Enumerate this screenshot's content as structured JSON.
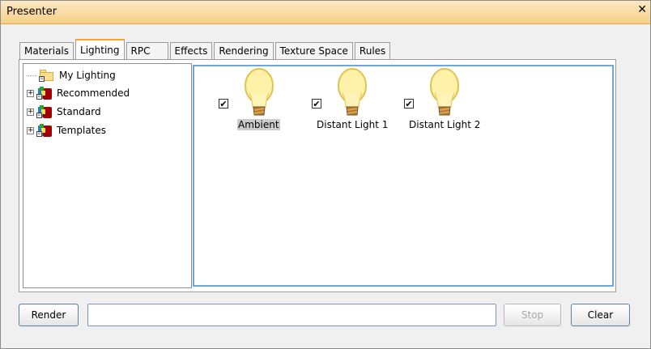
{
  "window": {
    "title": "Presenter",
    "close_icon": "close-icon"
  },
  "tabs": [
    {
      "label": "Materials"
    },
    {
      "label": "Lighting"
    },
    {
      "label": "RPC"
    },
    {
      "label": "Effects"
    },
    {
      "label": "Rendering"
    },
    {
      "label": "Texture Space"
    },
    {
      "label": "Rules"
    }
  ],
  "tree": [
    {
      "label": "My Lighting",
      "icon": "folder-icon",
      "expandable": false
    },
    {
      "label": "Recommended",
      "icon": "library-icon",
      "expandable": true
    },
    {
      "label": "Standard",
      "icon": "library-icon",
      "expandable": true
    },
    {
      "label": "Templates",
      "icon": "library-icon",
      "expandable": true
    }
  ],
  "lights": [
    {
      "label": "Ambient",
      "checked": true,
      "selected": true,
      "icon": "lightbulb-icon"
    },
    {
      "label": "Distant Light 1",
      "checked": true,
      "selected": false,
      "icon": "lightbulb-icon"
    },
    {
      "label": "Distant Light 2",
      "checked": true,
      "selected": false,
      "icon": "lightbulb-icon"
    }
  ],
  "bottom": {
    "render_label": "Render",
    "status_value": "",
    "stop_label": "Stop",
    "clear_label": "Clear"
  },
  "colors": {
    "titlebar": "#f7cf86",
    "active_tab_accent": "#f0a830",
    "selection_border": "#6ea7d8"
  }
}
